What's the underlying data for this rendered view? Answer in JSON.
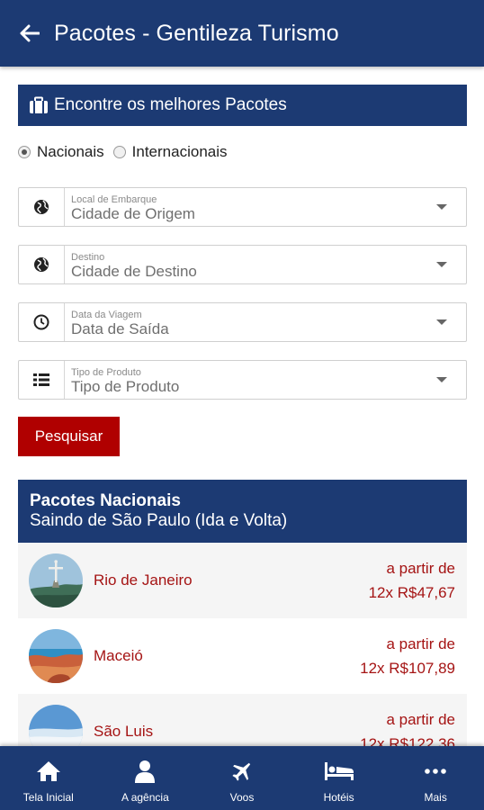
{
  "appbar": {
    "title": "Pacotes - Gentileza Turismo",
    "back_icon": "arrow-left-icon"
  },
  "search": {
    "header_label": "Encontre os melhores Pacotes",
    "radios": [
      {
        "label": "Nacionais",
        "selected": true
      },
      {
        "label": "Internacionais",
        "selected": false
      }
    ],
    "fields": [
      {
        "icon": "globe-icon",
        "small_label": "Local de Embarque",
        "value": "Cidade de Origem"
      },
      {
        "icon": "globe-icon",
        "small_label": "Destino",
        "value": "Cidade de Destino"
      },
      {
        "icon": "clock-icon",
        "small_label": "Data da Viagem",
        "value": "Data de Saída"
      },
      {
        "icon": "list-icon",
        "small_label": "Tipo de Produto",
        "value": "Tipo de Produto"
      }
    ],
    "button_label": "Pesquisar"
  },
  "packages": {
    "title": "Pacotes Nacionais",
    "subtitle": "Saindo de São Paulo (Ida e Volta)",
    "items": [
      {
        "city": "Rio de Janeiro",
        "price_line1": "a partir de",
        "price_line2": "12x R$47,67"
      },
      {
        "city": "Maceió",
        "price_line1": "a partir de",
        "price_line2": "12x R$107,89"
      },
      {
        "city": "São Luis",
        "price_line1": "a partir de",
        "price_line2": "12x R$122,36"
      }
    ]
  },
  "bottom_nav": [
    {
      "label": "Tela Inicial",
      "icon": "home-icon"
    },
    {
      "label": "A agência",
      "icon": "person-icon"
    },
    {
      "label": "Voos",
      "icon": "airplane-icon"
    },
    {
      "label": "Hotéis",
      "icon": "bed-icon"
    },
    {
      "label": "Mais",
      "icon": "more-dots-icon"
    }
  ],
  "colors": {
    "primary": "#1c3a73",
    "accent": "#b00000",
    "price": "#a51414"
  }
}
